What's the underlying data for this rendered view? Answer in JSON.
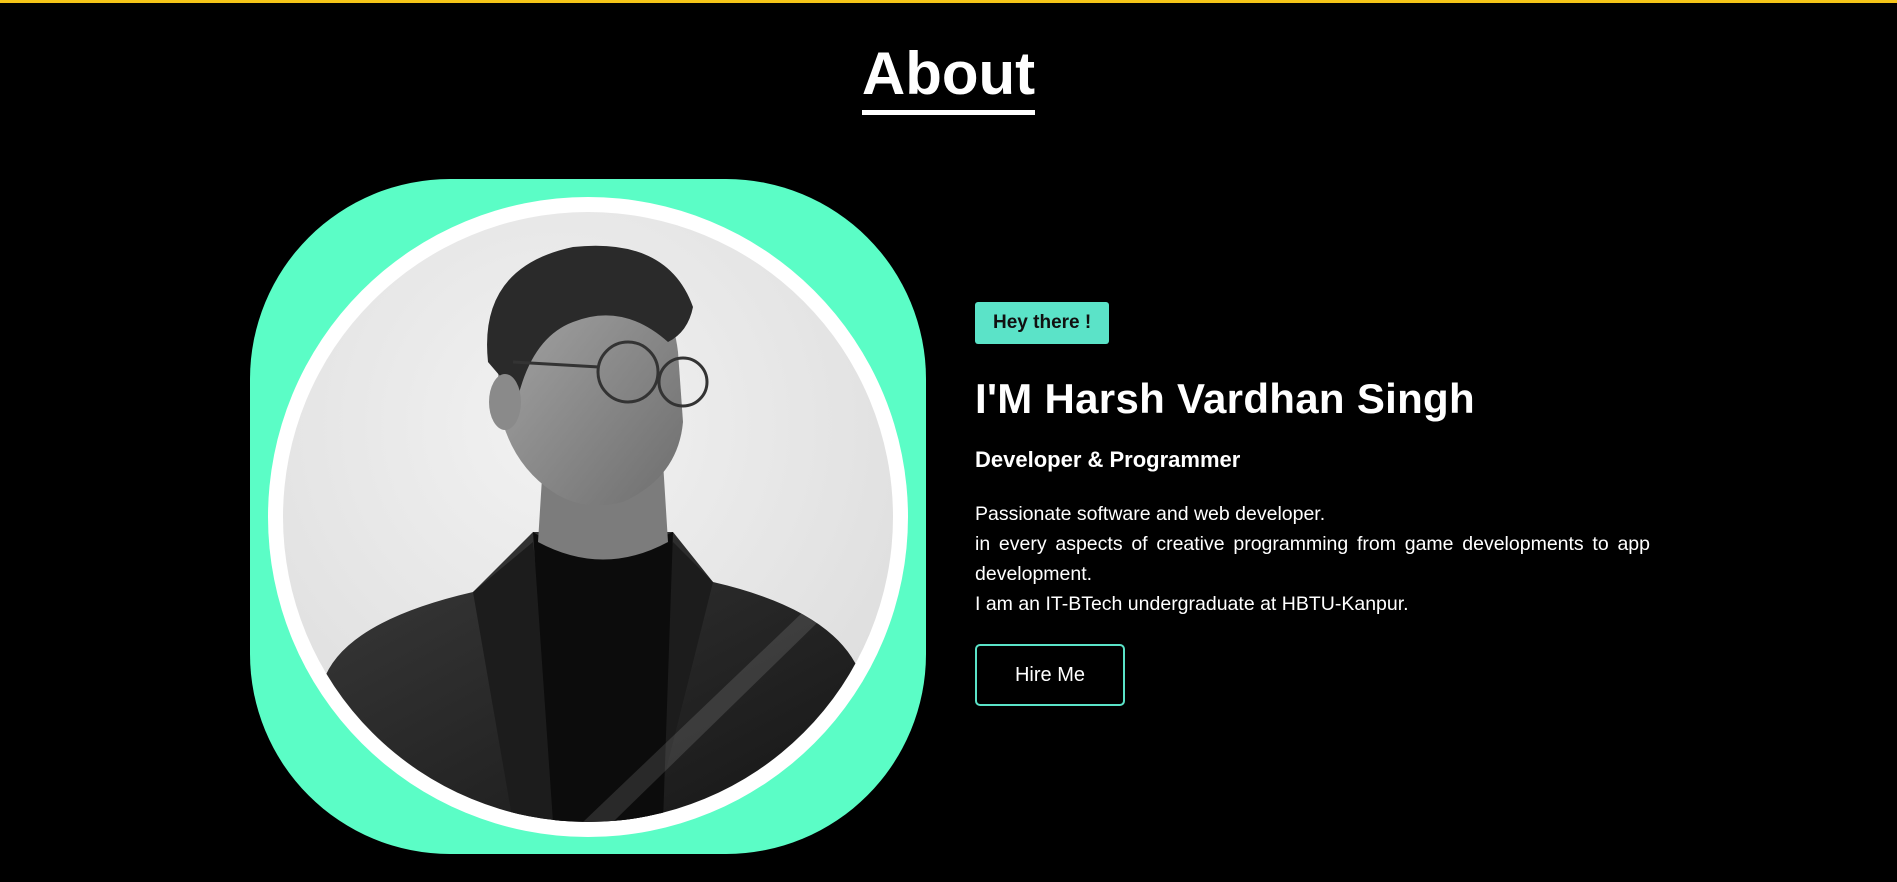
{
  "section": {
    "title": "About"
  },
  "intro": {
    "badge": "Hey there !",
    "name": "I'M Harsh Vardhan Singh",
    "role": "Developer & Programmer",
    "description_lines": [
      "Passionate software and web developer.",
      "in every aspects of creative programming from game developments to app development.",
      "I am an IT-BTech undergraduate at HBTU-Kanpur."
    ],
    "hire_button": "Hire Me"
  },
  "colors": {
    "background": "#000000",
    "top_border": "#f5c518",
    "accent": "#5bfdc6",
    "badge": "#5be3c8",
    "text": "#ffffff"
  },
  "icons": {
    "profile_photo": "portrait-photo"
  }
}
